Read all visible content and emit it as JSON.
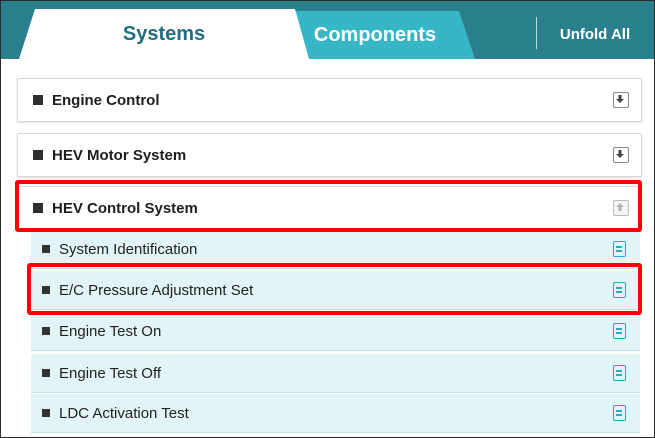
{
  "tabs": {
    "systems": "Systems",
    "components": "Components",
    "unfold_all": "Unfold All"
  },
  "groups": [
    {
      "label": "Engine Control",
      "icon": "download-icon",
      "expanded": false
    },
    {
      "label": "HEV Motor System",
      "icon": "download-icon",
      "expanded": false
    },
    {
      "label": "HEV Control System",
      "icon": "upload-icon",
      "expanded": true
    }
  ],
  "sub_items": [
    {
      "label": "System Identification",
      "icon": "document-icon"
    },
    {
      "label": "E/C Pressure Adjustment Set",
      "icon": "document-icon"
    },
    {
      "label": "Engine Test On",
      "icon": "document-icon"
    },
    {
      "label": "Engine Test Off",
      "icon": "document-icon"
    },
    {
      "label": "LDC Activation Test",
      "icon": "document-icon"
    }
  ],
  "colors": {
    "tab_bar": "#2a7f8c",
    "components_tab": "#37b6c6",
    "active_tab_text": "#1f6f80",
    "sub_row_bg": "#e3f4f7",
    "icon_accent": "#2fa8b8",
    "highlight": "#ff0000"
  }
}
